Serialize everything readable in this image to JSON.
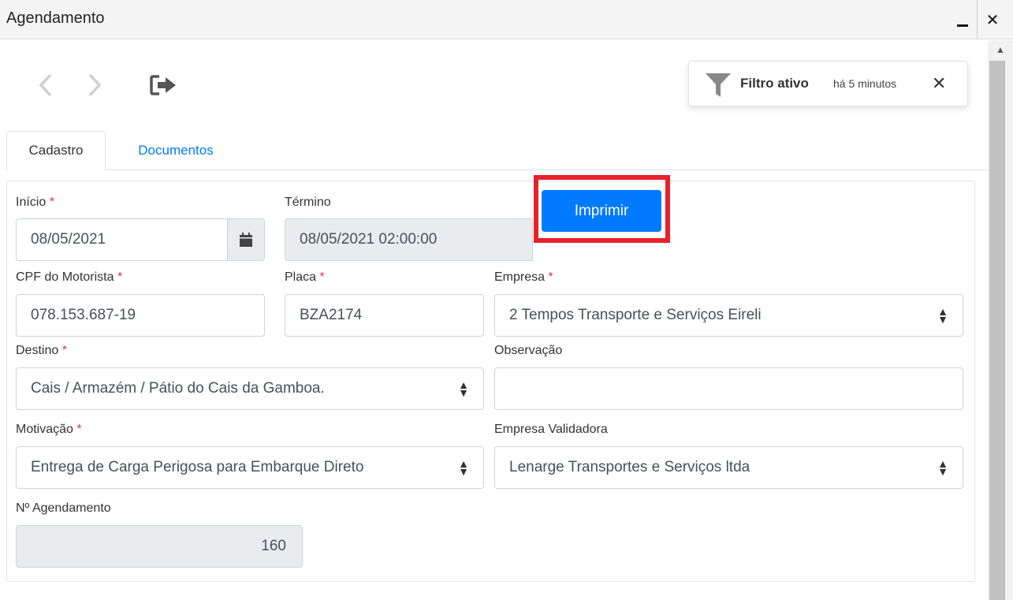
{
  "window": {
    "title": "Agendamento"
  },
  "toolbar": {
    "prev_icon": "chevron-left-icon",
    "next_icon": "chevron-right-icon",
    "exit_icon": "sign-out-icon"
  },
  "filter": {
    "label": "Filtro ativo",
    "time": "há 5 minutos",
    "close": "✕"
  },
  "tabs": [
    {
      "label": "Cadastro",
      "active": true
    },
    {
      "label": "Documentos",
      "active": false
    }
  ],
  "form": {
    "inicio": {
      "label": "Início",
      "value": "08/05/2021"
    },
    "termino": {
      "label": "Término",
      "value": "08/05/2021 02:00:00"
    },
    "print_button": "Imprimir",
    "cpf": {
      "label": "CPF do Motorista",
      "value": "078.153.687-19"
    },
    "placa": {
      "label": "Placa",
      "value": "BZA2174"
    },
    "empresa": {
      "label": "Empresa",
      "value": "2 Tempos Transporte e Serviços Eireli"
    },
    "destino": {
      "label": "Destino",
      "value": "Cais / Armazém / Pátio do Cais da Gamboa."
    },
    "observacao": {
      "label": "Observação",
      "value": ""
    },
    "motivacao": {
      "label": "Motivação",
      "value": "Entrega de Carga Perigosa para Embarque Direto"
    },
    "empresa_validadora": {
      "label": "Empresa Validadora",
      "value": "Lenarge Transportes e Serviços ltda"
    },
    "numero": {
      "label": "Nº Agendamento",
      "value": "160"
    },
    "required_mark": "*"
  },
  "colors": {
    "primary": "#007bff",
    "highlight": "#e8202a",
    "required": "#dc3545"
  }
}
